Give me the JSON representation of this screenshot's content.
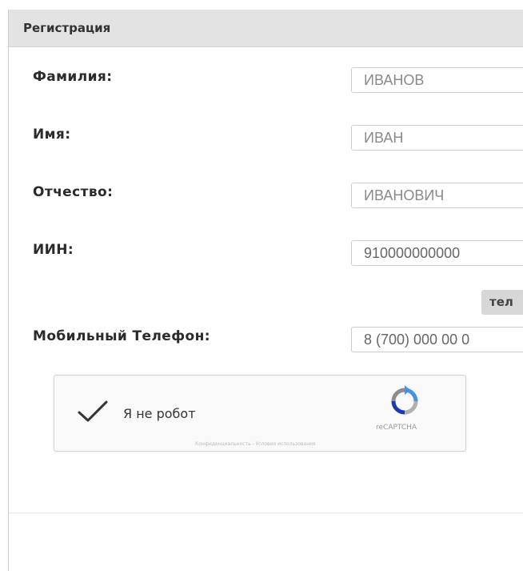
{
  "panel": {
    "title": "Регистрация"
  },
  "form": {
    "fields": [
      {
        "label": "Фамилия:",
        "value": "ИВАНОВ"
      },
      {
        "label": "Имя:",
        "value": "ИВАН"
      },
      {
        "label": "Отчество:",
        "value": "ИВАНОВИЧ"
      },
      {
        "label": "ИИН:",
        "value": "910000000000"
      },
      {
        "label": "Мобильный Телефон:",
        "value": "8 (700) 000 00 0"
      }
    ],
    "phone_button": "тел"
  },
  "captcha": {
    "label": "Я не робот",
    "brand": "reCAPTCHA",
    "links": "Конфиденциальность - Условия использования",
    "checked": true
  },
  "icons": [
    "checkmark-icon",
    "recaptcha-logo-icon"
  ],
  "colors": {
    "header_bg": "#e3e3e3",
    "check_color": "#333333"
  }
}
